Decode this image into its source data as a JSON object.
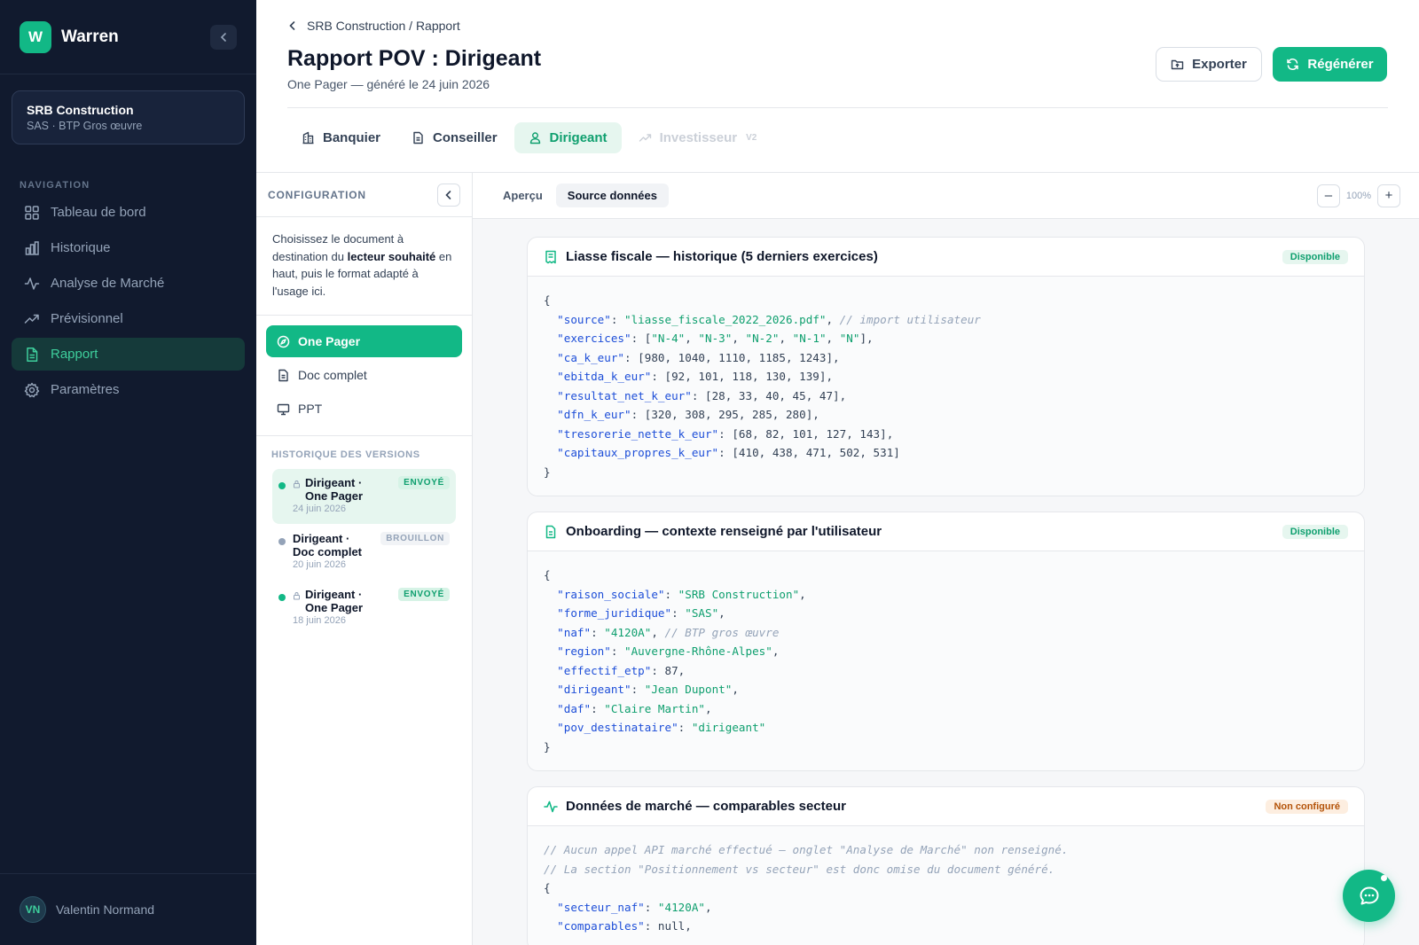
{
  "brand": {
    "logo_letter": "W",
    "name": "Warren"
  },
  "company": {
    "name": "SRB Construction",
    "subtitle": "SAS · BTP Gros œuvre"
  },
  "nav": {
    "title": "NAVIGATION",
    "items": [
      {
        "label": "Tableau de bord",
        "icon": "grid-icon"
      },
      {
        "label": "Historique",
        "icon": "bar-chart-icon"
      },
      {
        "label": "Analyse de Marché",
        "icon": "activity-icon"
      },
      {
        "label": "Prévisionnel",
        "icon": "trending-up-icon"
      },
      {
        "label": "Rapport",
        "icon": "file-text-icon",
        "active": true
      },
      {
        "label": "Paramètres",
        "icon": "gear-icon"
      }
    ]
  },
  "user": {
    "initials": "VN",
    "name": "Valentin Normand"
  },
  "header": {
    "breadcrumb": "SRB Construction / Rapport",
    "title": "Rapport POV : Dirigeant",
    "subtitle": "One Pager — généré le 24 juin 2026",
    "export_label": "Exporter",
    "regen_label": "Régénérer",
    "tabs": [
      {
        "label": "Banquier"
      },
      {
        "label": "Conseiller"
      },
      {
        "label": "Dirigeant",
        "active": true
      },
      {
        "label": "Investisseur",
        "badge": "V2",
        "disabled": true
      }
    ]
  },
  "config": {
    "title": "CONFIGURATION",
    "desc_part1": "Choisissez le document à destination du ",
    "desc_bold": "lecteur souhaité",
    "desc_part2": " en haut, puis le format adapté à l'usage ici.",
    "formats": [
      {
        "label": "One Pager",
        "active": true
      },
      {
        "label": "Doc complet"
      },
      {
        "label": "PPT"
      }
    ],
    "versions_title": "HISTORIQUE DES VERSIONS",
    "versions": [
      {
        "name": "Dirigeant · One Pager",
        "date": "24 juin 2026",
        "status": "ENVOYÉ",
        "locked": true,
        "active": true
      },
      {
        "name": "Dirigeant · Doc complet",
        "date": "20 juin 2026",
        "status": "BROUILLON",
        "locked": false
      },
      {
        "name": "Dirigeant · One Pager",
        "date": "18 juin 2026",
        "status": "ENVOYÉ",
        "locked": true
      }
    ]
  },
  "viewer": {
    "tabs": [
      {
        "label": "Aperçu"
      },
      {
        "label": "Source données",
        "active": true
      }
    ],
    "zoom": "100%",
    "zoom_out": "–",
    "zoom_in": "+"
  },
  "cards": [
    {
      "title": "Liasse fiscale — historique (5 derniers exercices)",
      "badge": "Disponible",
      "lines": [
        "{",
        "  \"source\": \"liasse_fiscale_2022_2026.pdf\", // import utilisateur",
        "  \"exercices\": [\"N-4\", \"N-3\", \"N-2\", \"N-1\", \"N\"],",
        "  \"ca_k_eur\": [980, 1040, 1110, 1185, 1243],",
        "  \"ebitda_k_eur\": [92, 101, 118, 130, 139],",
        "  \"resultat_net_k_eur\": [28, 33, 40, 45, 47],",
        "  \"dfn_k_eur\": [320, 308, 295, 285, 280],",
        "  \"tresorerie_nette_k_eur\": [68, 82, 101, 127, 143],",
        "  \"capitaux_propres_k_eur\": [410, 438, 471, 502, 531]",
        "}"
      ]
    },
    {
      "title": "Onboarding — contexte renseigné par l'utilisateur",
      "badge": "Disponible",
      "lines": [
        "{",
        "  \"raison_sociale\": \"SRB Construction\",",
        "  \"forme_juridique\": \"SAS\",",
        "  \"naf\": \"4120A\", // BTP gros œuvre",
        "  \"region\": \"Auvergne-Rhône-Alpes\",",
        "  \"effectif_etp\": 87,",
        "  \"dirigeant\": \"Jean Dupont\",",
        "  \"daf\": \"Claire Martin\",",
        "  \"pov_destinataire\": \"dirigeant\"",
        "}"
      ]
    },
    {
      "title": "Données de marché — comparables secteur",
      "badge": "Non configuré",
      "warn": true,
      "lines": [
        "// Aucun appel API marché effectué — onglet \"Analyse de Marché\" non renseigné.",
        "// La section \"Positionnement vs secteur\" est donc omise du document généré.",
        "{",
        "  \"secteur_naf\": \"4120A\",",
        "  \"comparables\": null,"
      ]
    }
  ],
  "colors": {
    "accent": "#12b886",
    "sidebar_bg": "#111a2e",
    "active_nav": "#3ecf9c"
  }
}
